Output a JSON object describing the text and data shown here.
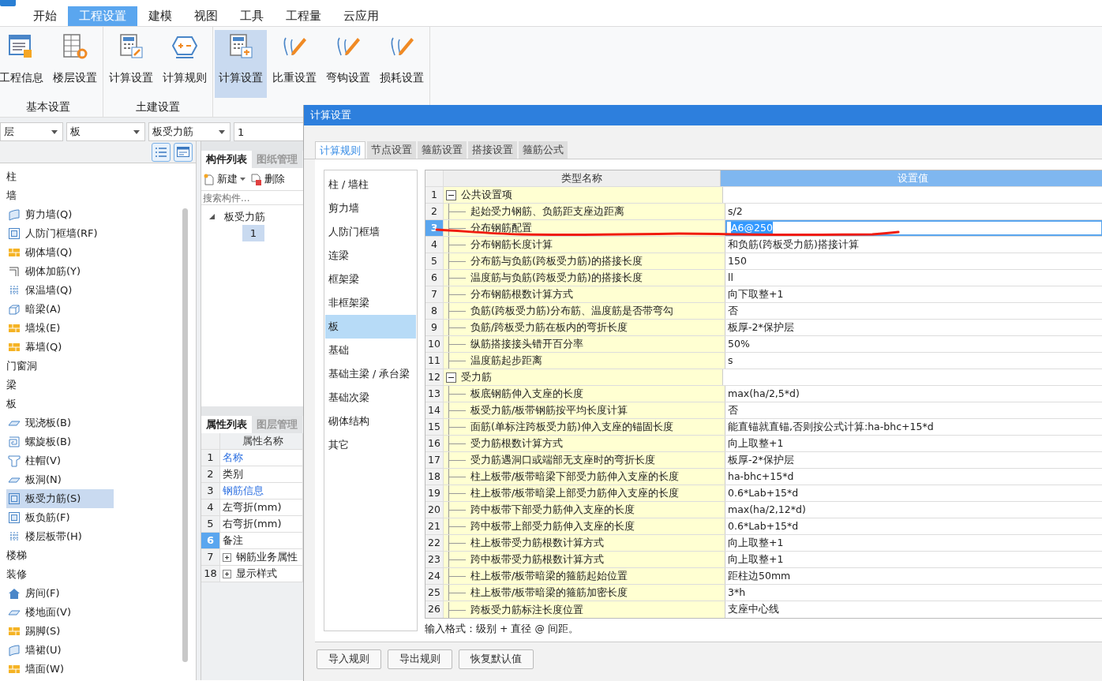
{
  "menu_tabs": [
    {
      "label": "开始",
      "selected": false
    },
    {
      "label": "工程设置",
      "selected": true
    },
    {
      "label": "建模",
      "selected": false
    },
    {
      "label": "视图",
      "selected": false
    },
    {
      "label": "工具",
      "selected": false
    },
    {
      "label": "工程量",
      "selected": false
    },
    {
      "label": "云应用",
      "selected": false
    }
  ],
  "ribbon": [
    {
      "label": "基本设置",
      "buttons": [
        {
          "label": "工程信息",
          "selected": false
        },
        {
          "label": "楼层设置",
          "selected": false
        }
      ]
    },
    {
      "label": "土建设置",
      "buttons": [
        {
          "label": "计算设置",
          "selected": false
        },
        {
          "label": "计算规则",
          "selected": false
        }
      ]
    },
    {
      "buttons": [
        {
          "label": "计算设置",
          "selected": true
        },
        {
          "label": "比重设置",
          "selected": false
        },
        {
          "label": "弯钩设置",
          "selected": false
        },
        {
          "label": "损耗设置",
          "selected": false
        }
      ]
    }
  ],
  "filters": [
    {
      "kind": "dropdown",
      "value": "层"
    },
    {
      "kind": "dropdown",
      "value": "板"
    },
    {
      "kind": "dropdown",
      "value": "板受力筋"
    },
    {
      "kind": "field",
      "value": "1"
    }
  ],
  "component_tree": [
    {
      "label": "柱"
    },
    {
      "label": "墙",
      "children": [
        {
          "label": "剪力墙(Q)",
          "selected": false
        },
        {
          "label": "人防门框墙(RF)",
          "selected": false
        },
        {
          "label": "砌体墙(Q)",
          "selected": false
        },
        {
          "label": "砌体加筋(Y)",
          "selected": false
        },
        {
          "label": "保温墙(Q)",
          "selected": false
        },
        {
          "label": "暗梁(A)",
          "selected": false
        },
        {
          "label": "墙垛(E)",
          "selected": false
        },
        {
          "label": "幕墙(Q)",
          "selected": false
        }
      ]
    },
    {
      "label": "门窗洞"
    },
    {
      "label": "梁"
    },
    {
      "label": "板",
      "children": [
        {
          "label": "现浇板(B)",
          "selected": false
        },
        {
          "label": "螺旋板(B)",
          "selected": false
        },
        {
          "label": "柱帽(V)",
          "selected": false
        },
        {
          "label": "板洞(N)",
          "selected": false
        },
        {
          "label": "板受力筋(S)",
          "selected": true
        },
        {
          "label": "板负筋(F)",
          "selected": false
        },
        {
          "label": "楼层板带(H)",
          "selected": false
        }
      ]
    },
    {
      "label": "楼梯"
    },
    {
      "label": "装修",
      "children": [
        {
          "label": "房间(F)",
          "selected": false
        },
        {
          "label": "楼地面(V)",
          "selected": false
        },
        {
          "label": "踢脚(S)",
          "selected": false
        },
        {
          "label": "墙裙(U)",
          "selected": false
        },
        {
          "label": "墙面(W)",
          "selected": false
        }
      ]
    }
  ],
  "component_list": {
    "tabs": [
      {
        "label": "构件列表",
        "selected": true
      },
      {
        "label": "图纸管理",
        "selected": false
      }
    ],
    "new_button": "新建",
    "delete_button": "删除",
    "search": {
      "placeholder": "搜索构件..."
    },
    "tree": [
      {
        "label": "板受力筋",
        "expanded": true,
        "children": [
          {
            "label": "1",
            "selected": true
          }
        ]
      }
    ]
  },
  "properties": {
    "tabs": [
      {
        "label": "属性列表",
        "selected": true
      },
      {
        "label": "图层管理",
        "selected": false
      }
    ],
    "header": "属性名称",
    "rows": [
      {
        "num": "1",
        "name": "名称",
        "kind": "public",
        "selected": false
      },
      {
        "num": "2",
        "name": "类别",
        "kind": "private",
        "selected": false
      },
      {
        "num": "3",
        "name": "钢筋信息",
        "kind": "public",
        "selected": false
      },
      {
        "num": "4",
        "name": "左弯折(mm)",
        "kind": "private",
        "selected": false
      },
      {
        "num": "5",
        "name": "右弯折(mm)",
        "kind": "private",
        "selected": false
      },
      {
        "num": "6",
        "name": "备注",
        "kind": "private",
        "selected": true
      },
      {
        "num": "7",
        "name": "钢筋业务属性",
        "kind": "group",
        "expanded": false,
        "selected": false
      },
      {
        "num": "18",
        "name": "显示样式",
        "kind": "group",
        "expanded": false,
        "selected": false
      }
    ]
  },
  "dialog": {
    "title": "计算设置",
    "tabs": [
      {
        "label": "计算规则",
        "selected": true
      },
      {
        "label": "节点设置",
        "selected": false
      },
      {
        "label": "箍筋设置",
        "selected": false
      },
      {
        "label": "搭接设置",
        "selected": false
      },
      {
        "label": "箍筋公式",
        "selected": false
      }
    ],
    "categories": [
      {
        "label": "柱 / 墙柱",
        "selected": false
      },
      {
        "label": "剪力墙",
        "selected": false
      },
      {
        "label": "人防门框墙",
        "selected": false
      },
      {
        "label": "连梁",
        "selected": false
      },
      {
        "label": "框架梁",
        "selected": false
      },
      {
        "label": "非框架梁",
        "selected": false
      },
      {
        "label": "板",
        "selected": true
      },
      {
        "label": "基础",
        "selected": false
      },
      {
        "label": "基础主梁 / 承台梁",
        "selected": false
      },
      {
        "label": "基础次梁",
        "selected": false
      },
      {
        "label": "砌体结构",
        "selected": false
      },
      {
        "label": "其它",
        "selected": false
      }
    ],
    "columns": [
      "类型名称",
      "设置值"
    ],
    "rows": [
      {
        "num": "1",
        "kind": "group",
        "expanded": true,
        "name": "公共设置项",
        "selected": false
      },
      {
        "num": "2",
        "kind": "item",
        "name": "起始受力钢筋、负筋距支座边距离",
        "value": "s/2",
        "selected": false
      },
      {
        "num": "3",
        "kind": "item",
        "name": "分布钢筋配置",
        "value": "A6@250",
        "selected": true
      },
      {
        "num": "4",
        "kind": "item",
        "name": "分布钢筋长度计算",
        "value": "和负筋(跨板受力筋)搭接计算",
        "selected": false
      },
      {
        "num": "5",
        "kind": "item",
        "name": "分布筋与负筋(跨板受力筋)的搭接长度",
        "value": "150",
        "selected": false
      },
      {
        "num": "6",
        "kind": "item",
        "name": "温度筋与负筋(跨板受力筋)的搭接长度",
        "value": "ll",
        "selected": false
      },
      {
        "num": "7",
        "kind": "item",
        "name": "分布钢筋根数计算方式",
        "value": "向下取整+1",
        "selected": false
      },
      {
        "num": "8",
        "kind": "item",
        "name": "负筋(跨板受力筋)分布筋、温度筋是否带弯勾",
        "value": "否",
        "selected": false
      },
      {
        "num": "9",
        "kind": "item",
        "name": "负筋/跨板受力筋在板内的弯折长度",
        "value": "板厚-2*保护层",
        "selected": false
      },
      {
        "num": "10",
        "kind": "item",
        "name": "纵筋搭接接头错开百分率",
        "value": "50%",
        "selected": false
      },
      {
        "num": "11",
        "kind": "item",
        "name": "温度筋起步距离",
        "value": "s",
        "selected": false
      },
      {
        "num": "12",
        "kind": "group",
        "expanded": true,
        "name": "受力筋",
        "selected": false
      },
      {
        "num": "13",
        "kind": "item",
        "name": "板底钢筋伸入支座的长度",
        "value": "max(ha/2,5*d)",
        "selected": false
      },
      {
        "num": "14",
        "kind": "item",
        "name": "板受力筋/板带钢筋按平均长度计算",
        "value": "否",
        "selected": false
      },
      {
        "num": "15",
        "kind": "item",
        "name": "面筋(单标注跨板受力筋)伸入支座的锚固长度",
        "value": "能直锚就直锚,否则按公式计算:ha-bhc+15*d",
        "selected": false
      },
      {
        "num": "16",
        "kind": "item",
        "name": "受力筋根数计算方式",
        "value": "向上取整+1",
        "selected": false
      },
      {
        "num": "17",
        "kind": "item",
        "name": "受力筋遇洞口或端部无支座时的弯折长度",
        "value": "板厚-2*保护层",
        "selected": false
      },
      {
        "num": "18",
        "kind": "item",
        "name": "柱上板带/板带暗梁下部受力筋伸入支座的长度",
        "value": "ha-bhc+15*d",
        "selected": false
      },
      {
        "num": "19",
        "kind": "item",
        "name": "柱上板带/板带暗梁上部受力筋伸入支座的长度",
        "value": "0.6*Lab+15*d",
        "selected": false
      },
      {
        "num": "20",
        "kind": "item",
        "name": "跨中板带下部受力筋伸入支座的长度",
        "value": "max(ha/2,12*d)",
        "selected": false
      },
      {
        "num": "21",
        "kind": "item",
        "name": "跨中板带上部受力筋伸入支座的长度",
        "value": "0.6*Lab+15*d",
        "selected": false
      },
      {
        "num": "22",
        "kind": "item",
        "name": "柱上板带受力筋根数计算方式",
        "value": "向上取整+1",
        "selected": false
      },
      {
        "num": "23",
        "kind": "item",
        "name": "跨中板带受力筋根数计算方式",
        "value": "向上取整+1",
        "selected": false
      },
      {
        "num": "24",
        "kind": "item",
        "name": "柱上板带/板带暗梁的箍筋起始位置",
        "value": "距柱边50mm",
        "selected": false
      },
      {
        "num": "25",
        "kind": "item",
        "name": "柱上板带/板带暗梁的箍筋加密长度",
        "value": "3*h",
        "selected": false
      },
      {
        "num": "26",
        "kind": "item",
        "name": "跨板受力筋标注长度位置",
        "value": "支座中心线",
        "selected": false
      }
    ],
    "hint": "输入格式：级别 + 直径 @ 间距。",
    "buttons": [
      "导入规则",
      "导出规则",
      "恢复默认值"
    ]
  }
}
